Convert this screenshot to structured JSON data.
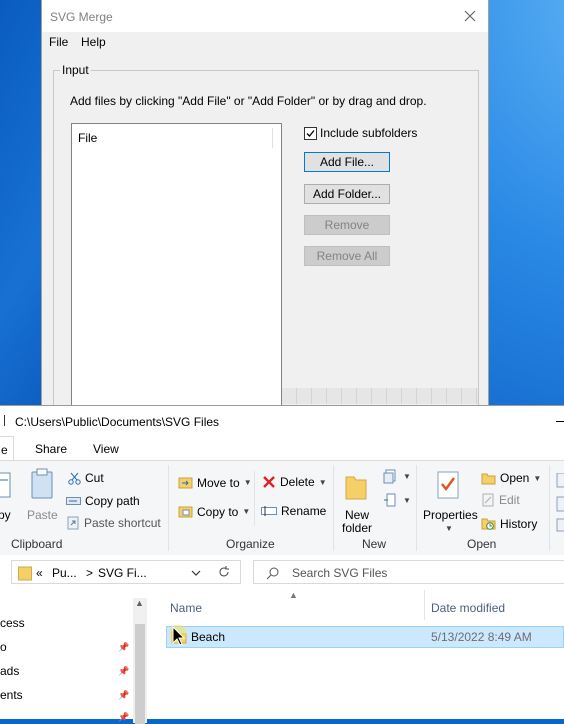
{
  "merge_window": {
    "title": "SVG Merge",
    "menu": [
      "File",
      "Help"
    ],
    "group_label": "Input",
    "instructions": "Add files by clicking \"Add File\" or \"Add Folder\" or by drag and drop.",
    "file_column_header": "File",
    "include_subfolders_label": "Include subfolders",
    "include_subfolders_checked": true,
    "buttons": {
      "add_file": "Add File...",
      "add_folder": "Add Folder...",
      "remove": "Remove",
      "remove_all": "Remove All"
    }
  },
  "explorer": {
    "title_path": "C:\\Users\\Public\\Documents\\SVG Files",
    "tabs": {
      "file": "e",
      "share": "Share",
      "view": "View"
    },
    "ribbon": {
      "clipboard": {
        "label": "Clipboard",
        "copy": "py",
        "paste": "Paste",
        "cut": "Cut",
        "copy_path": "Copy path",
        "paste_shortcut": "Paste shortcut"
      },
      "organize": {
        "label": "Organize",
        "move_to": "Move to",
        "copy_to": "Copy to",
        "delete": "Delete",
        "rename": "Rename"
      },
      "new": {
        "label": "New",
        "new_folder_line1": "New",
        "new_folder_line2": "folder"
      },
      "open": {
        "label": "Open",
        "properties": "Properties",
        "open": "Open",
        "edit": "Edit",
        "history": "History"
      }
    },
    "address": {
      "chevrons": "«",
      "crumb1": "Pu...",
      "sep": ">",
      "crumb2": "SVG Fi..."
    },
    "search_placeholder": "Search SVG Files",
    "nav_items": [
      "cess",
      "o",
      "ads",
      "ents"
    ],
    "columns": {
      "name": "Name",
      "date_modified": "Date modified"
    },
    "files": [
      {
        "name": "Beach",
        "date": "5/13/2022 8:49 AM"
      }
    ]
  },
  "colors": {
    "accent": "#0078d7",
    "selection": "#cce8ff",
    "desktop": "#0b5fc6"
  }
}
